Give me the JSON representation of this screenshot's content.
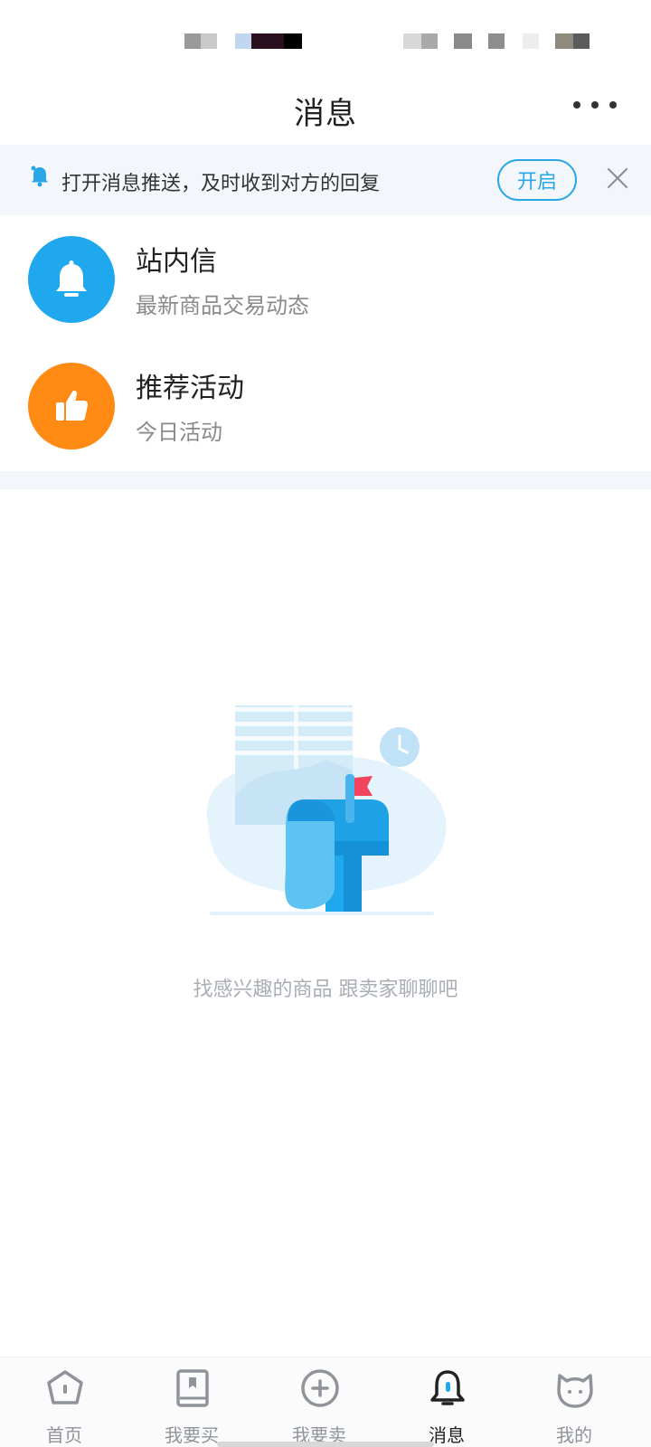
{
  "header": {
    "title": "消息"
  },
  "push_banner": {
    "text": "打开消息推送，及时收到对方的回复",
    "open_label": "开启"
  },
  "messages": [
    {
      "title": "站内信",
      "subtitle": "最新商品交易动态",
      "icon": "bell-icon",
      "color": "#1fa8ee"
    },
    {
      "title": "推荐活动",
      "subtitle": "今日活动",
      "icon": "thumbs-up-icon",
      "color": "#ff8a14"
    }
  ],
  "empty_state": {
    "text": "找感兴趣的商品 跟卖家聊聊吧",
    "icon": "mailbox-icon"
  },
  "tabs": [
    {
      "label": "首页",
      "icon": "home-icon",
      "active": false
    },
    {
      "label": "我要买",
      "icon": "book-icon",
      "active": false
    },
    {
      "label": "我要卖",
      "icon": "plus-circle-icon",
      "active": false
    },
    {
      "label": "消息",
      "icon": "bell-icon",
      "active": true
    },
    {
      "label": "我的",
      "icon": "cat-icon",
      "active": false
    }
  ],
  "colors": {
    "accent": "#2aa7e6",
    "bell_blue": "#1fa8ee",
    "orange": "#ff8a14",
    "banner_bg": "#f3f6fa"
  }
}
